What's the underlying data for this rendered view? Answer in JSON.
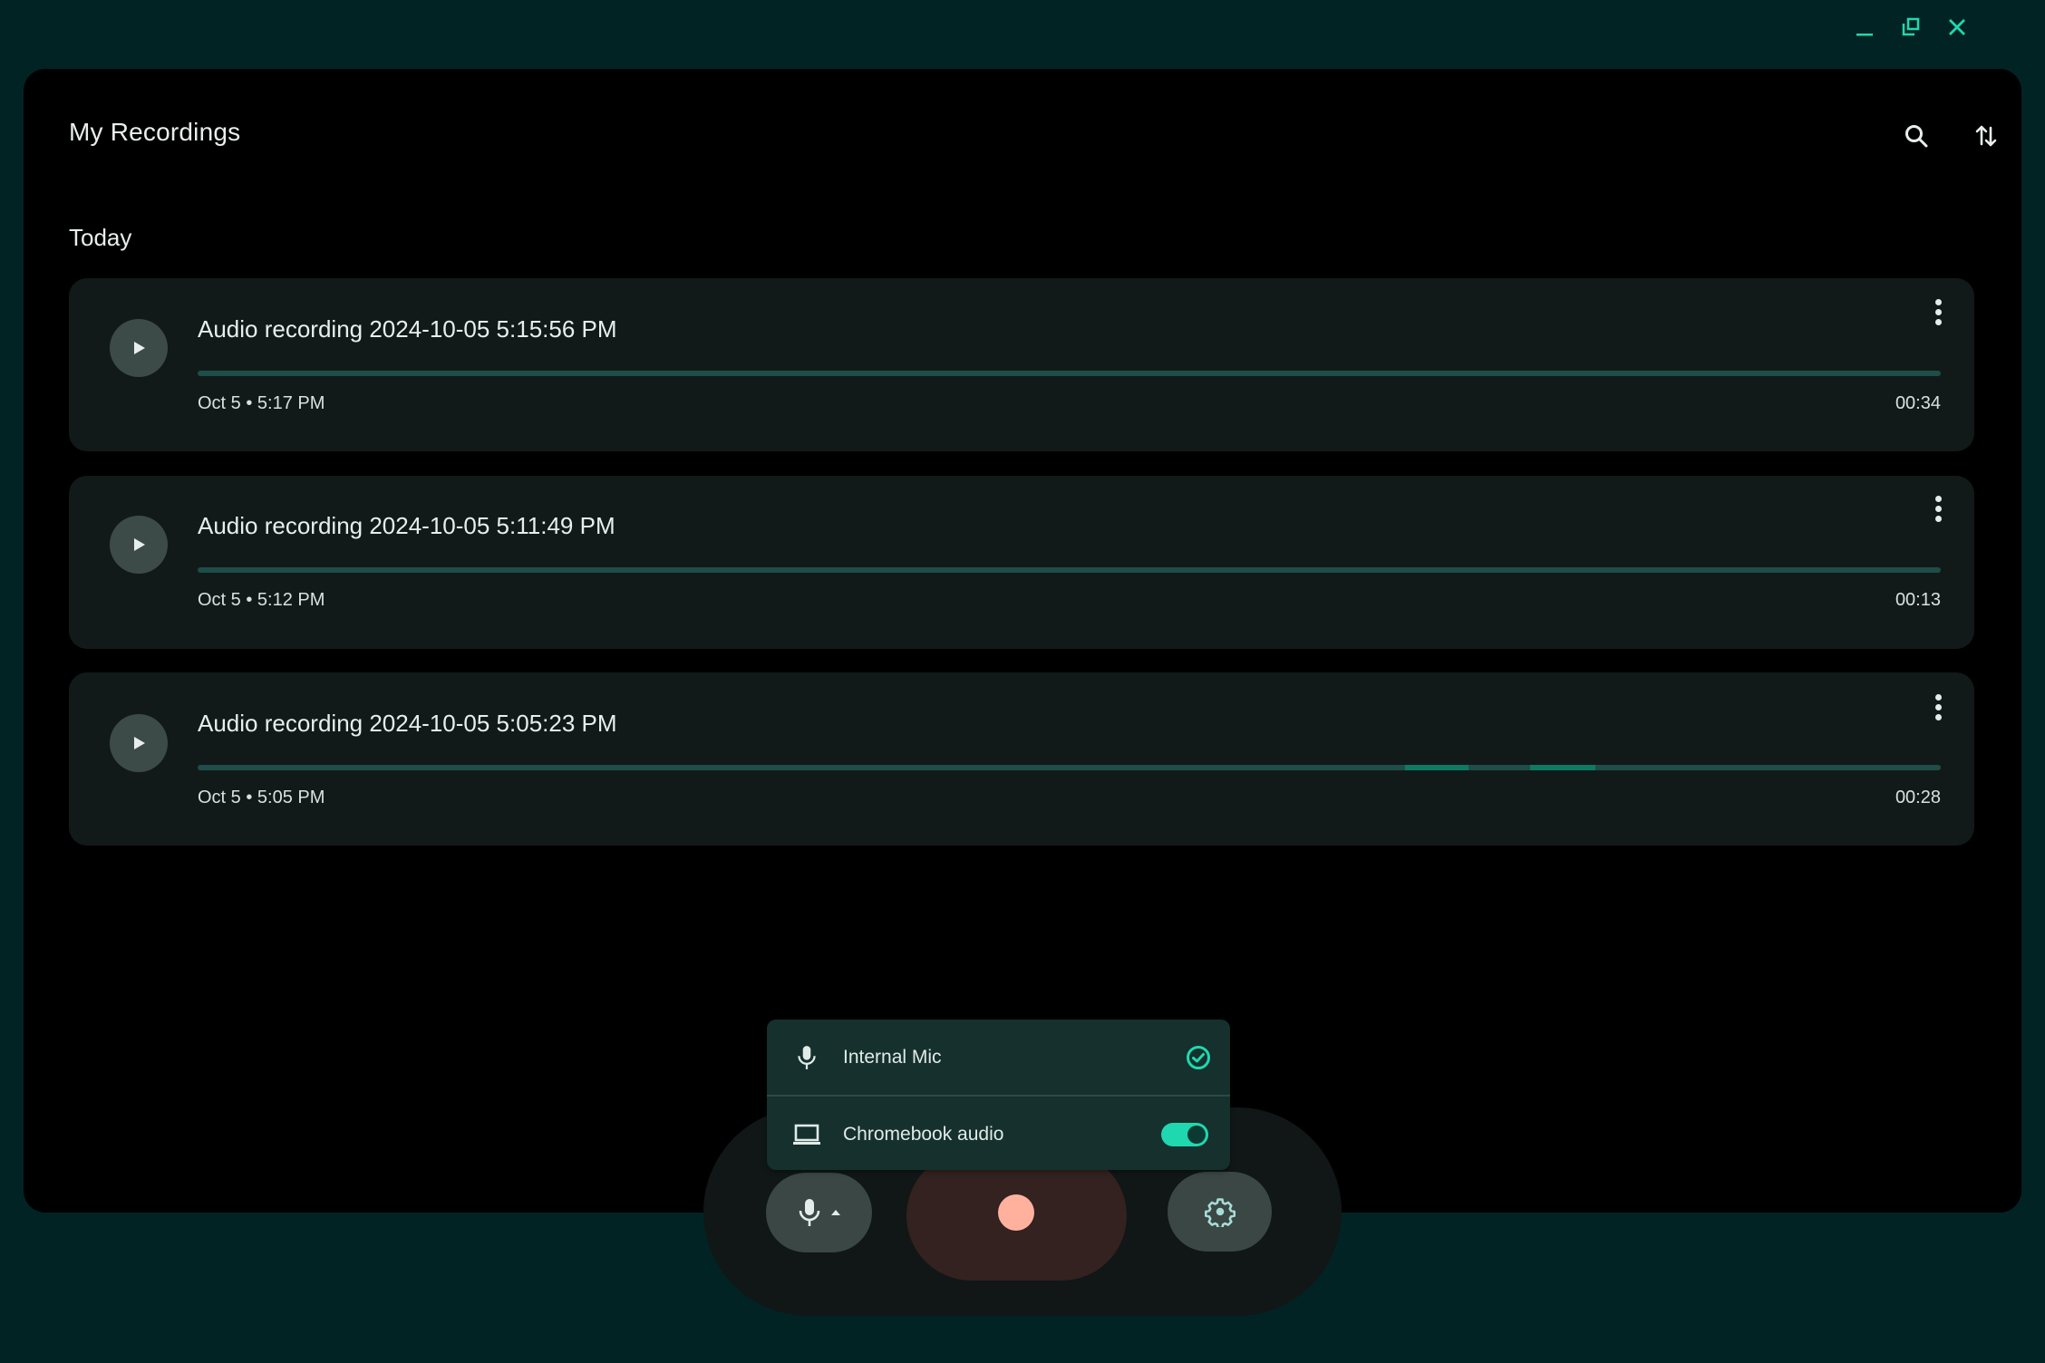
{
  "window": {
    "controls": [
      {
        "name": "minimize-icon",
        "label": "Minimize"
      },
      {
        "name": "restore-icon",
        "label": "Restore"
      },
      {
        "name": "close-icon",
        "label": "Close"
      }
    ],
    "accent_color": "#1fd8b0"
  },
  "header": {
    "title": "My Recordings",
    "search_icon": "search-icon",
    "sort_icon": "sort-arrows-icon"
  },
  "sections": [
    {
      "label": "Today",
      "recordings": [
        {
          "title": "Audio recording 2024-10-05 5:15:56 PM",
          "date": "Oct 5",
          "time": "5:17 PM",
          "meta": "Oct 5 • 5:17 PM",
          "duration": "00:34"
        },
        {
          "title": "Audio recording 2024-10-05 5:11:49 PM",
          "date": "Oct 5",
          "time": "5:12 PM",
          "meta": "Oct 5 • 5:12 PM",
          "duration": "00:13"
        },
        {
          "title": "Audio recording 2024-10-05 5:05:23 PM",
          "date": "Oct 5",
          "time": "5:05 PM",
          "meta": "Oct 5 • 5:05 PM",
          "duration": "00:28"
        }
      ]
    }
  ],
  "audio_source_menu": {
    "items": [
      {
        "label": "Internal Mic",
        "icon": "microphone-icon",
        "control": "check",
        "selected": true
      },
      {
        "label": "Chromebook audio",
        "icon": "laptop-icon",
        "control": "toggle",
        "enabled": true
      }
    ]
  },
  "controls": {
    "mic_button_icon": "microphone-icon",
    "record_button_icon": "record-icon",
    "record_color": "#ffb19e",
    "settings_button_icon": "gear-icon"
  }
}
